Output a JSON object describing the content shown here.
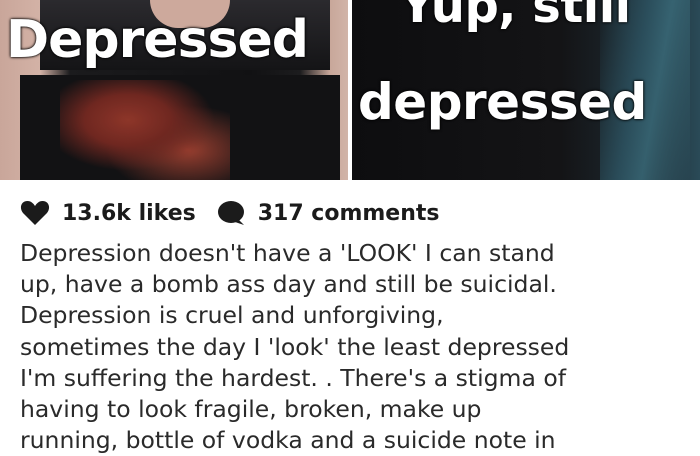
{
  "photos": {
    "left_caption": "Depressed",
    "right_caption_line1": "Yup, still",
    "right_caption_line2": "depressed"
  },
  "stats": {
    "likes_icon": "heart-icon",
    "likes": "13.6k likes",
    "comments_icon": "speech-bubble-icon",
    "comments": "317 comments"
  },
  "post": {
    "body": "Depression doesn't have a 'LOOK' I can stand\nup, have a bomb ass day and still be suicidal.\nDepression is cruel and unforgiving,\nsometimes the day I 'look' the least depressed\nI'm suffering the hardest. . There's a stigma of\nhaving to look fragile, broken, make up\nrunning, bottle of vodka and a suicide note in"
  },
  "colors": {
    "text": "#2a2a2a",
    "icon": "#1b1b1b",
    "caption": "#ffffff"
  }
}
